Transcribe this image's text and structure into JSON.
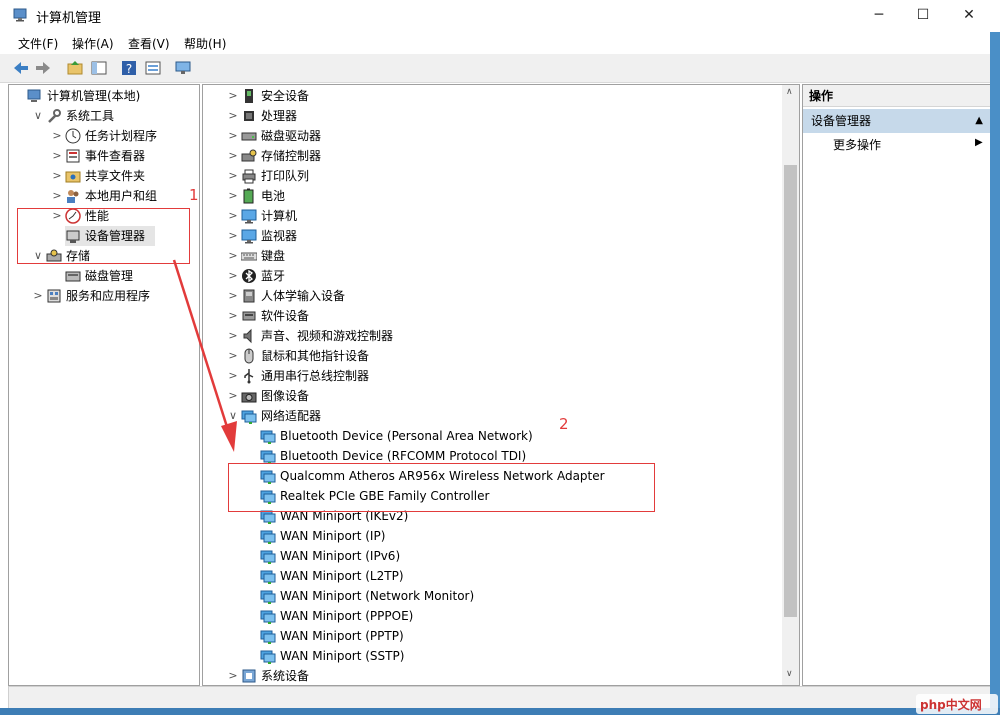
{
  "window": {
    "title": "计算机管理"
  },
  "menu": [
    "文件(F)",
    "操作(A)",
    "查看(V)",
    "帮助(H)"
  ],
  "left_tree": [
    {
      "label": "计算机管理(本地)",
      "level": 0,
      "chev": "",
      "icon": "computer-manage-icon"
    },
    {
      "label": "系统工具",
      "level": 1,
      "chev": "∨",
      "icon": "tools-icon"
    },
    {
      "label": "任务计划程序",
      "level": 2,
      "chev": ">",
      "icon": "clock-icon"
    },
    {
      "label": "事件查看器",
      "level": 2,
      "chev": ">",
      "icon": "event-viewer-icon"
    },
    {
      "label": "共享文件夹",
      "level": 2,
      "chev": ">",
      "icon": "shared-folder-icon"
    },
    {
      "label": "本地用户和组",
      "level": 2,
      "chev": ">",
      "icon": "users-icon"
    },
    {
      "label": "性能",
      "level": 2,
      "chev": ">",
      "icon": "performance-icon"
    },
    {
      "label": "设备管理器",
      "level": 2,
      "chev": "",
      "icon": "device-manager-icon",
      "selected": true
    },
    {
      "label": "存储",
      "level": 1,
      "chev": "∨",
      "icon": "storage-icon"
    },
    {
      "label": "磁盘管理",
      "level": 2,
      "chev": "",
      "icon": "disk-icon"
    },
    {
      "label": "服务和应用程序",
      "level": 1,
      "chev": ">",
      "icon": "services-icon"
    }
  ],
  "device_tree": [
    {
      "label": "安全设备",
      "level": 0,
      "chev": ">",
      "icon": "security-device-icon"
    },
    {
      "label": "处理器",
      "level": 0,
      "chev": ">",
      "icon": "processor-icon"
    },
    {
      "label": "磁盘驱动器",
      "level": 0,
      "chev": ">",
      "icon": "disk-drive-icon"
    },
    {
      "label": "存储控制器",
      "level": 0,
      "chev": ">",
      "icon": "storage-controller-icon"
    },
    {
      "label": "打印队列",
      "level": 0,
      "chev": ">",
      "icon": "printer-icon"
    },
    {
      "label": "电池",
      "level": 0,
      "chev": ">",
      "icon": "battery-icon"
    },
    {
      "label": "计算机",
      "level": 0,
      "chev": ">",
      "icon": "monitor-icon"
    },
    {
      "label": "监视器",
      "level": 0,
      "chev": ">",
      "icon": "monitor-icon"
    },
    {
      "label": "键盘",
      "level": 0,
      "chev": ">",
      "icon": "keyboard-icon"
    },
    {
      "label": "蓝牙",
      "level": 0,
      "chev": ">",
      "icon": "bluetooth-icon"
    },
    {
      "label": "人体学输入设备",
      "level": 0,
      "chev": ">",
      "icon": "hid-icon"
    },
    {
      "label": "软件设备",
      "level": 0,
      "chev": ">",
      "icon": "software-device-icon"
    },
    {
      "label": "声音、视频和游戏控制器",
      "level": 0,
      "chev": ">",
      "icon": "speaker-icon"
    },
    {
      "label": "鼠标和其他指针设备",
      "level": 0,
      "chev": ">",
      "icon": "mouse-icon"
    },
    {
      "label": "通用串行总线控制器",
      "level": 0,
      "chev": ">",
      "icon": "usb-icon"
    },
    {
      "label": "图像设备",
      "level": 0,
      "chev": ">",
      "icon": "camera-icon"
    },
    {
      "label": "网络适配器",
      "level": 0,
      "chev": "∨",
      "icon": "network-adapter-icon"
    },
    {
      "label": "Bluetooth Device (Personal Area Network)",
      "level": 1,
      "chev": "",
      "icon": "network-adapter-icon"
    },
    {
      "label": "Bluetooth Device (RFCOMM Protocol TDI)",
      "level": 1,
      "chev": "",
      "icon": "network-adapter-icon"
    },
    {
      "label": "Qualcomm Atheros AR956x Wireless Network Adapter",
      "level": 1,
      "chev": "",
      "icon": "network-adapter-icon"
    },
    {
      "label": "Realtek PCIe GBE Family Controller",
      "level": 1,
      "chev": "",
      "icon": "network-adapter-icon"
    },
    {
      "label": "WAN Miniport (IKEv2)",
      "level": 1,
      "chev": "",
      "icon": "network-adapter-icon"
    },
    {
      "label": "WAN Miniport (IP)",
      "level": 1,
      "chev": "",
      "icon": "network-adapter-icon"
    },
    {
      "label": "WAN Miniport (IPv6)",
      "level": 1,
      "chev": "",
      "icon": "network-adapter-icon"
    },
    {
      "label": "WAN Miniport (L2TP)",
      "level": 1,
      "chev": "",
      "icon": "network-adapter-icon"
    },
    {
      "label": "WAN Miniport (Network Monitor)",
      "level": 1,
      "chev": "",
      "icon": "network-adapter-icon"
    },
    {
      "label": "WAN Miniport (PPPOE)",
      "level": 1,
      "chev": "",
      "icon": "network-adapter-icon"
    },
    {
      "label": "WAN Miniport (PPTP)",
      "level": 1,
      "chev": "",
      "icon": "network-adapter-icon"
    },
    {
      "label": "WAN Miniport (SSTP)",
      "level": 1,
      "chev": "",
      "icon": "network-adapter-icon"
    },
    {
      "label": "系统设备",
      "level": 0,
      "chev": ">",
      "icon": "system-device-icon"
    }
  ],
  "actions": {
    "header": "操作",
    "section": "设备管理器",
    "more": "更多操作"
  },
  "annotations": {
    "label1": "1",
    "label2": "2"
  },
  "watermark": "php中文网",
  "colors": {
    "accent_arrow": "#e23b3b",
    "selected_section": "#c6d9ea"
  }
}
